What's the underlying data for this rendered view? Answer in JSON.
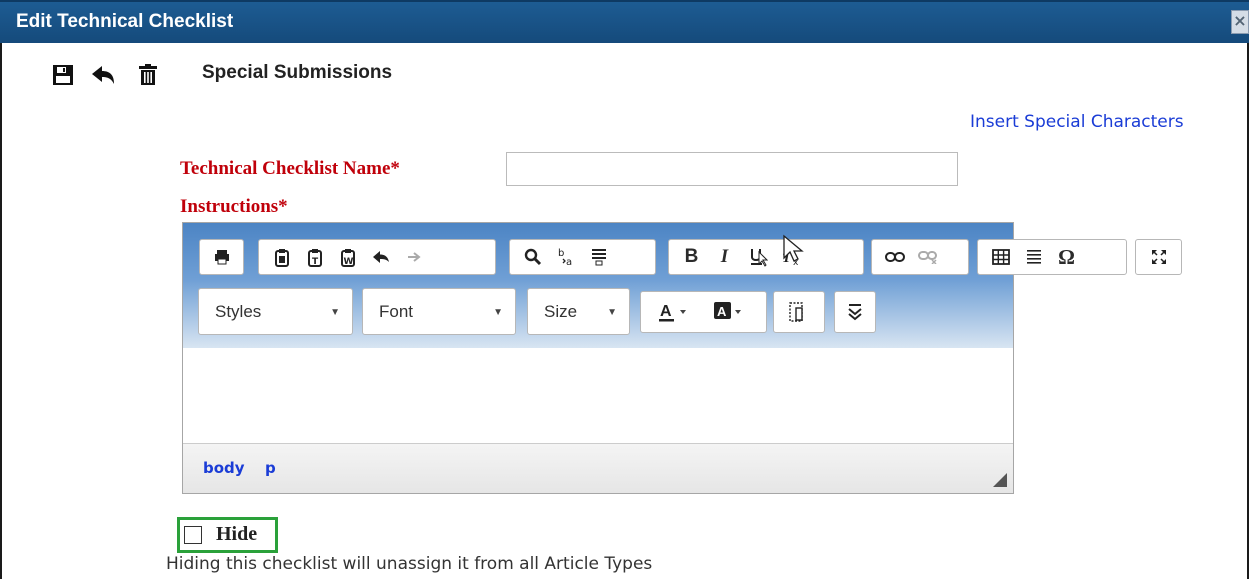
{
  "dialog": {
    "title": "Edit Technical Checklist",
    "close_symbol": "×"
  },
  "toolbar": {
    "save_icon": "save-icon",
    "back_icon": "back-arrow-icon",
    "delete_icon": "trash-icon"
  },
  "page_name": "Special Submissions",
  "insert_special_link": "Insert Special Characters",
  "form": {
    "checklist_name_label": "Technical Checklist Name*",
    "checklist_name_value": "",
    "instructions_label": "Instructions*"
  },
  "editor": {
    "styles_label": "Styles",
    "font_label": "Font",
    "size_label": "Size",
    "path": [
      "body",
      "p"
    ]
  },
  "hide": {
    "label": "Hide",
    "checked": false,
    "note": "Hiding this checklist will unassign it from all Article Types"
  },
  "colors": {
    "title_bar": "#1d5c93",
    "required_label": "#c0000a",
    "link": "#1a3cd6",
    "hide_highlight": "#2aa13a"
  }
}
